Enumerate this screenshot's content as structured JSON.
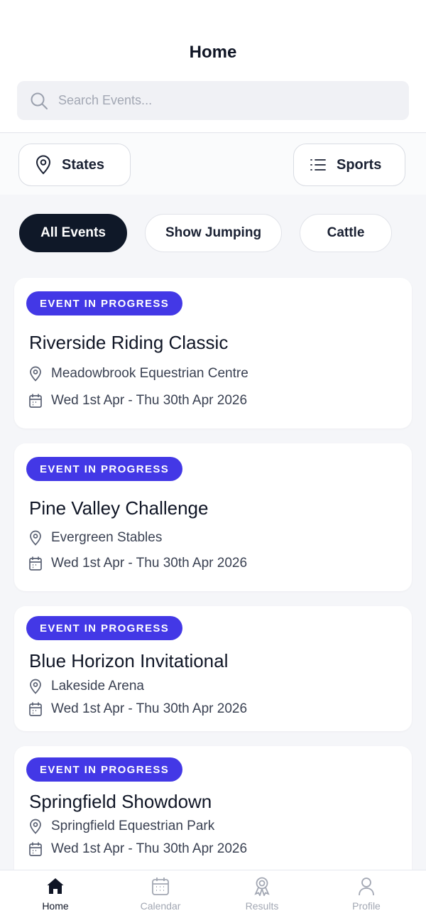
{
  "header": {
    "title": "Home"
  },
  "search": {
    "placeholder": "Search Events..."
  },
  "filters": {
    "states_label": "States",
    "sports_label": "Sports"
  },
  "chips": [
    {
      "label": "All Events",
      "active": true
    },
    {
      "label": "Show Jumping",
      "active": false
    },
    {
      "label": "Cattle",
      "active": false
    }
  ],
  "events": [
    {
      "status": "EVENT IN PROGRESS",
      "title": "Riverside Riding Classic",
      "venue": "Meadowbrook Equestrian Centre",
      "dates": "Wed 1st Apr - Thu 30th Apr 2026"
    },
    {
      "status": "EVENT IN PROGRESS",
      "title": "Pine Valley Challenge",
      "venue": "Evergreen Stables",
      "dates": "Wed 1st Apr - Thu 30th Apr 2026"
    },
    {
      "status": "EVENT IN PROGRESS",
      "title": "Blue Horizon Invitational",
      "venue": "Lakeside Arena",
      "dates": "Wed 1st Apr - Thu 30th Apr 2026"
    },
    {
      "status": "EVENT IN PROGRESS",
      "title": "Springfield Showdown",
      "venue": "Springfield Equestrian Park",
      "dates": "Wed 1st Apr - Thu 30th Apr 2026"
    }
  ],
  "tabbar": {
    "items": [
      {
        "label": "Home",
        "icon": "home-icon",
        "active": true
      },
      {
        "label": "Calendar",
        "icon": "calendar-icon",
        "active": false
      },
      {
        "label": "Results",
        "icon": "award-icon",
        "active": false
      },
      {
        "label": "Profile",
        "icon": "user-icon",
        "active": false
      }
    ]
  },
  "colors": {
    "accent": "#4338e6",
    "active_chip": "#0f1828",
    "background": "#f5f6f9"
  }
}
